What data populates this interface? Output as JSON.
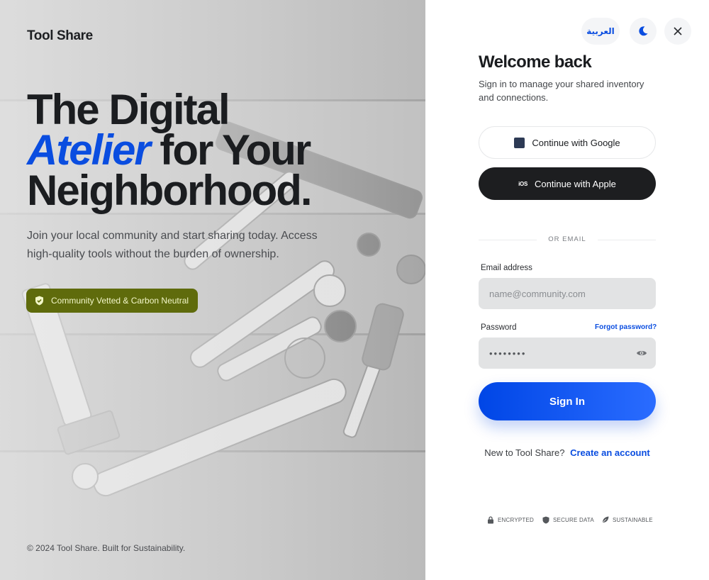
{
  "hero": {
    "brand": "Tool Share",
    "headline_line1": "The Digital",
    "headline_accent": "Atelier",
    "headline_line2_rest": " for Your",
    "headline_line3": "Neighborhood.",
    "subtext": "Join your local community and start sharing today. Access high-quality tools without the burden of ownership.",
    "badge_label": "Community Vetted & Carbon Neutral",
    "badge_icon": "shield-check-icon",
    "footer": "© 2024 Tool Share. Built for Sustainability."
  },
  "topbar": {
    "language_label": "العربية",
    "theme_icon": "moon-icon",
    "close_icon": "close-icon"
  },
  "form": {
    "title": "Welcome back",
    "intro": "Sign in to manage your shared inventory and connections.",
    "google_label": "Continue with Google",
    "apple_label": "Continue with Apple",
    "apple_icon_text": "iOS",
    "divider_text": "OR EMAIL",
    "email_label": "Email address",
    "email_placeholder": "name@community.com",
    "password_label": "Password",
    "forgot_label": "Forgot password?",
    "password_value": "••••••••",
    "signin_label": "Sign In",
    "signup_prompt": "New to Tool Share?",
    "signup_link": "Create an account"
  },
  "trust": [
    {
      "label": "ENCRYPTED",
      "icon": "lock-icon"
    },
    {
      "label": "SECURE DATA",
      "icon": "shield-icon"
    },
    {
      "label": "SUSTAINABLE",
      "icon": "leaf-icon"
    }
  ],
  "colors": {
    "accent": "#0a4de0",
    "badge": "#5f6b0c",
    "apple_button": "#1d1e20"
  }
}
